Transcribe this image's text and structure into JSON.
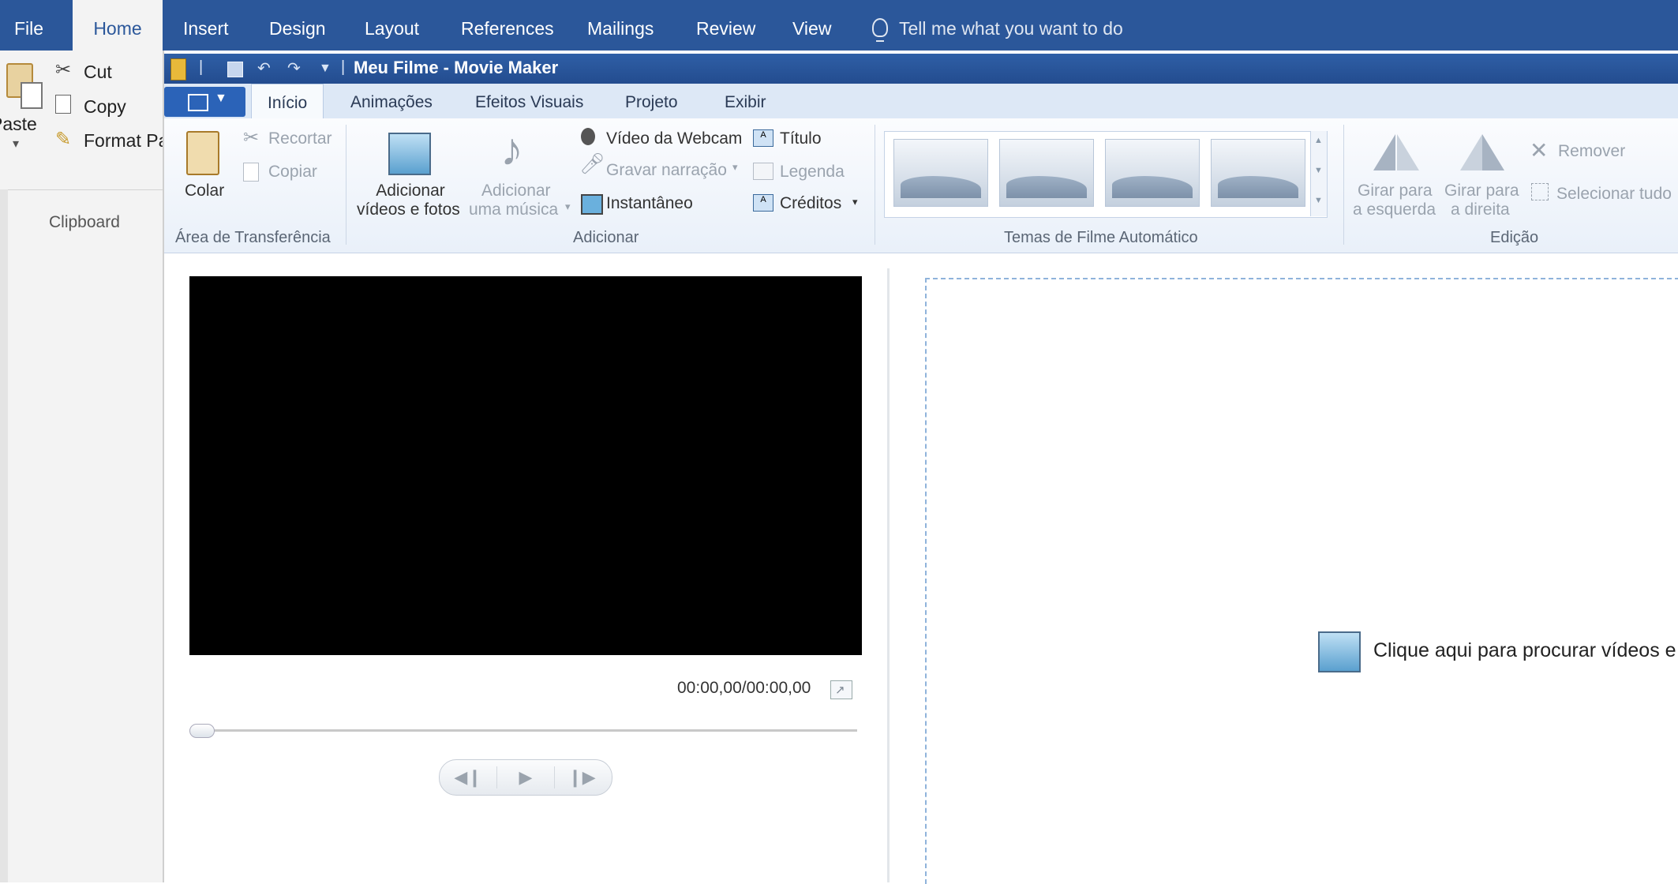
{
  "word": {
    "tabs": [
      "File",
      "Home",
      "Insert",
      "Design",
      "Layout",
      "References",
      "Mailings",
      "Review",
      "View"
    ],
    "active_tab": "Home",
    "tell_me": "Tell me what you want to do",
    "clipboard": {
      "paste": "Paste",
      "cut": "Cut",
      "copy": "Copy",
      "format_painter": "Format Pa",
      "group_label": "Clipboard"
    }
  },
  "moviemaker": {
    "title": "Meu Filme - Movie Maker",
    "tabs": [
      "Início",
      "Animações",
      "Efeitos Visuais",
      "Projeto",
      "Exibir"
    ],
    "active_tab": "Início",
    "ribbon": {
      "transfer": {
        "paste": "Colar",
        "cut": "Recortar",
        "copy": "Copiar",
        "label": "Área de Transferência"
      },
      "add": {
        "add_videos_line1": "Adicionar",
        "add_videos_line2": "vídeos e fotos",
        "add_music_line1": "Adicionar",
        "add_music_line2": "uma música",
        "webcam": "Vídeo da Webcam",
        "narration": "Gravar narração",
        "snapshot": "Instantâneo",
        "title": "Título",
        "caption": "Legenda",
        "credits": "Créditos",
        "label": "Adicionar"
      },
      "themes": {
        "label": "Temas de Filme Automático"
      },
      "editing": {
        "rotate_left_line1": "Girar para",
        "rotate_left_line2": "a esquerda",
        "rotate_right_line1": "Girar para",
        "rotate_right_line2": "a direita",
        "remove": "Remover",
        "select_all": "Selecionar tudo",
        "label": "Edição"
      }
    },
    "player": {
      "timecode": "00:00,00/00:00,00"
    },
    "storyboard": {
      "prompt": "Clique aqui para procurar vídeos e"
    }
  }
}
